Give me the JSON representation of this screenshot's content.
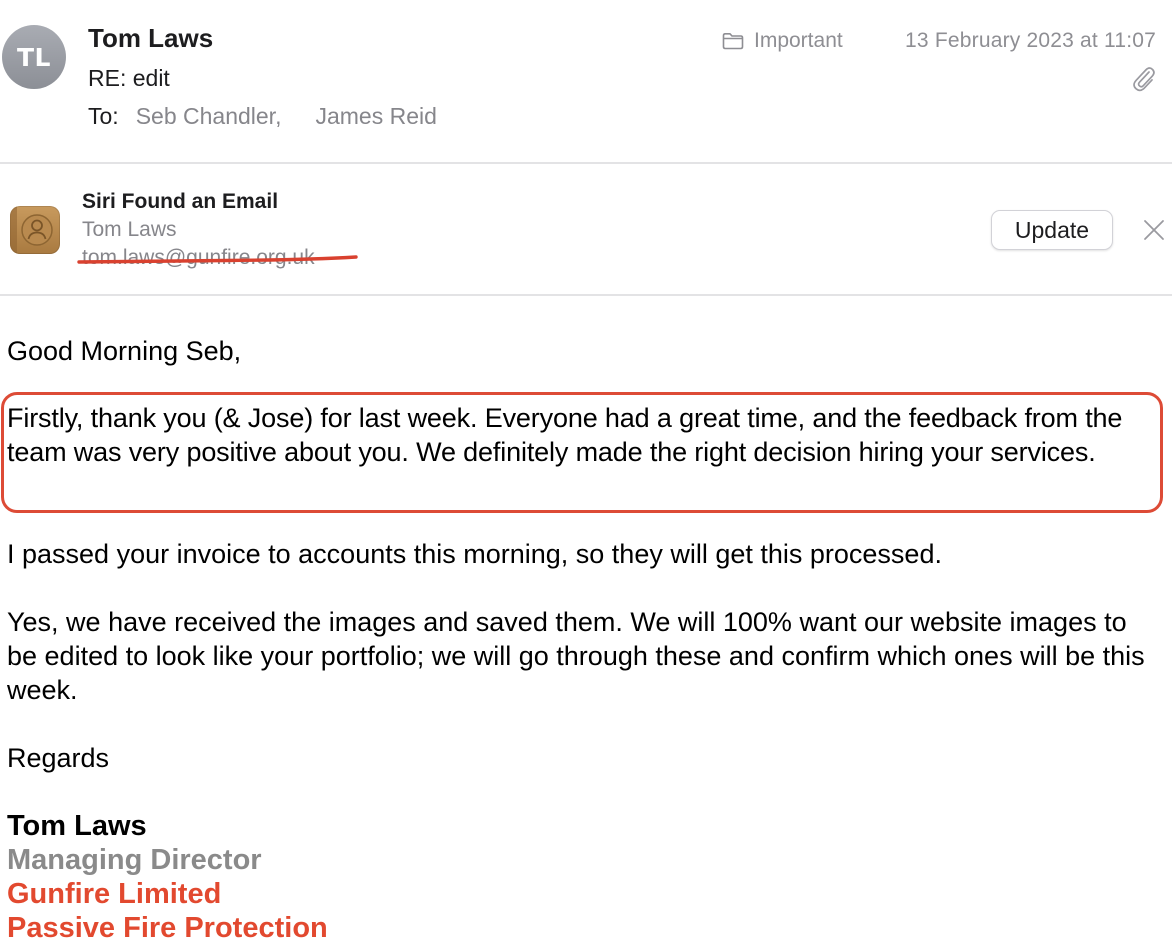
{
  "header": {
    "avatar_initials": "TL",
    "sender_name": "Tom Laws",
    "subject": "RE: edit",
    "to_label": "To:",
    "recipients": [
      "Seb Chandler,",
      "James Reid"
    ],
    "mailbox": "Important",
    "date": "13 February 2023 at 11:07",
    "icons": {
      "mailbox": "folder-icon",
      "attachment": "paperclip-icon"
    }
  },
  "siri_banner": {
    "title": "Siri Found an Email",
    "contact_name": "Tom Laws",
    "contact_email": "tom.laws@gunfire.org.uk",
    "update_label": "Update",
    "icons": {
      "app": "contacts-icon",
      "dismiss": "close-icon"
    }
  },
  "body": {
    "greeting": "Good Morning Seb,",
    "para_1": "Firstly, thank you (& Jose) for last week. Everyone had a great time, and the feedback from the team was very positive about you. We definitely made the right decision hiring your services.",
    "para_2": "I passed your invoice to accounts this morning, so they will get this processed.",
    "para_3": "Yes, we have received the images and saved them. We will 100% want our website images to be edited to look like your portfolio; we will go through these and confirm which ones will be this week.",
    "closing": "Regards"
  },
  "signature": {
    "name": "Tom Laws",
    "role": "Managing Director",
    "company": "Gunfire Limited",
    "tagline": "Passive Fire Protection"
  },
  "colors": {
    "annotation_red": "#dd4b36",
    "signature_red": "#e2492f",
    "signature_grey": "#8a8a8a",
    "secondary_text": "#86868b"
  }
}
